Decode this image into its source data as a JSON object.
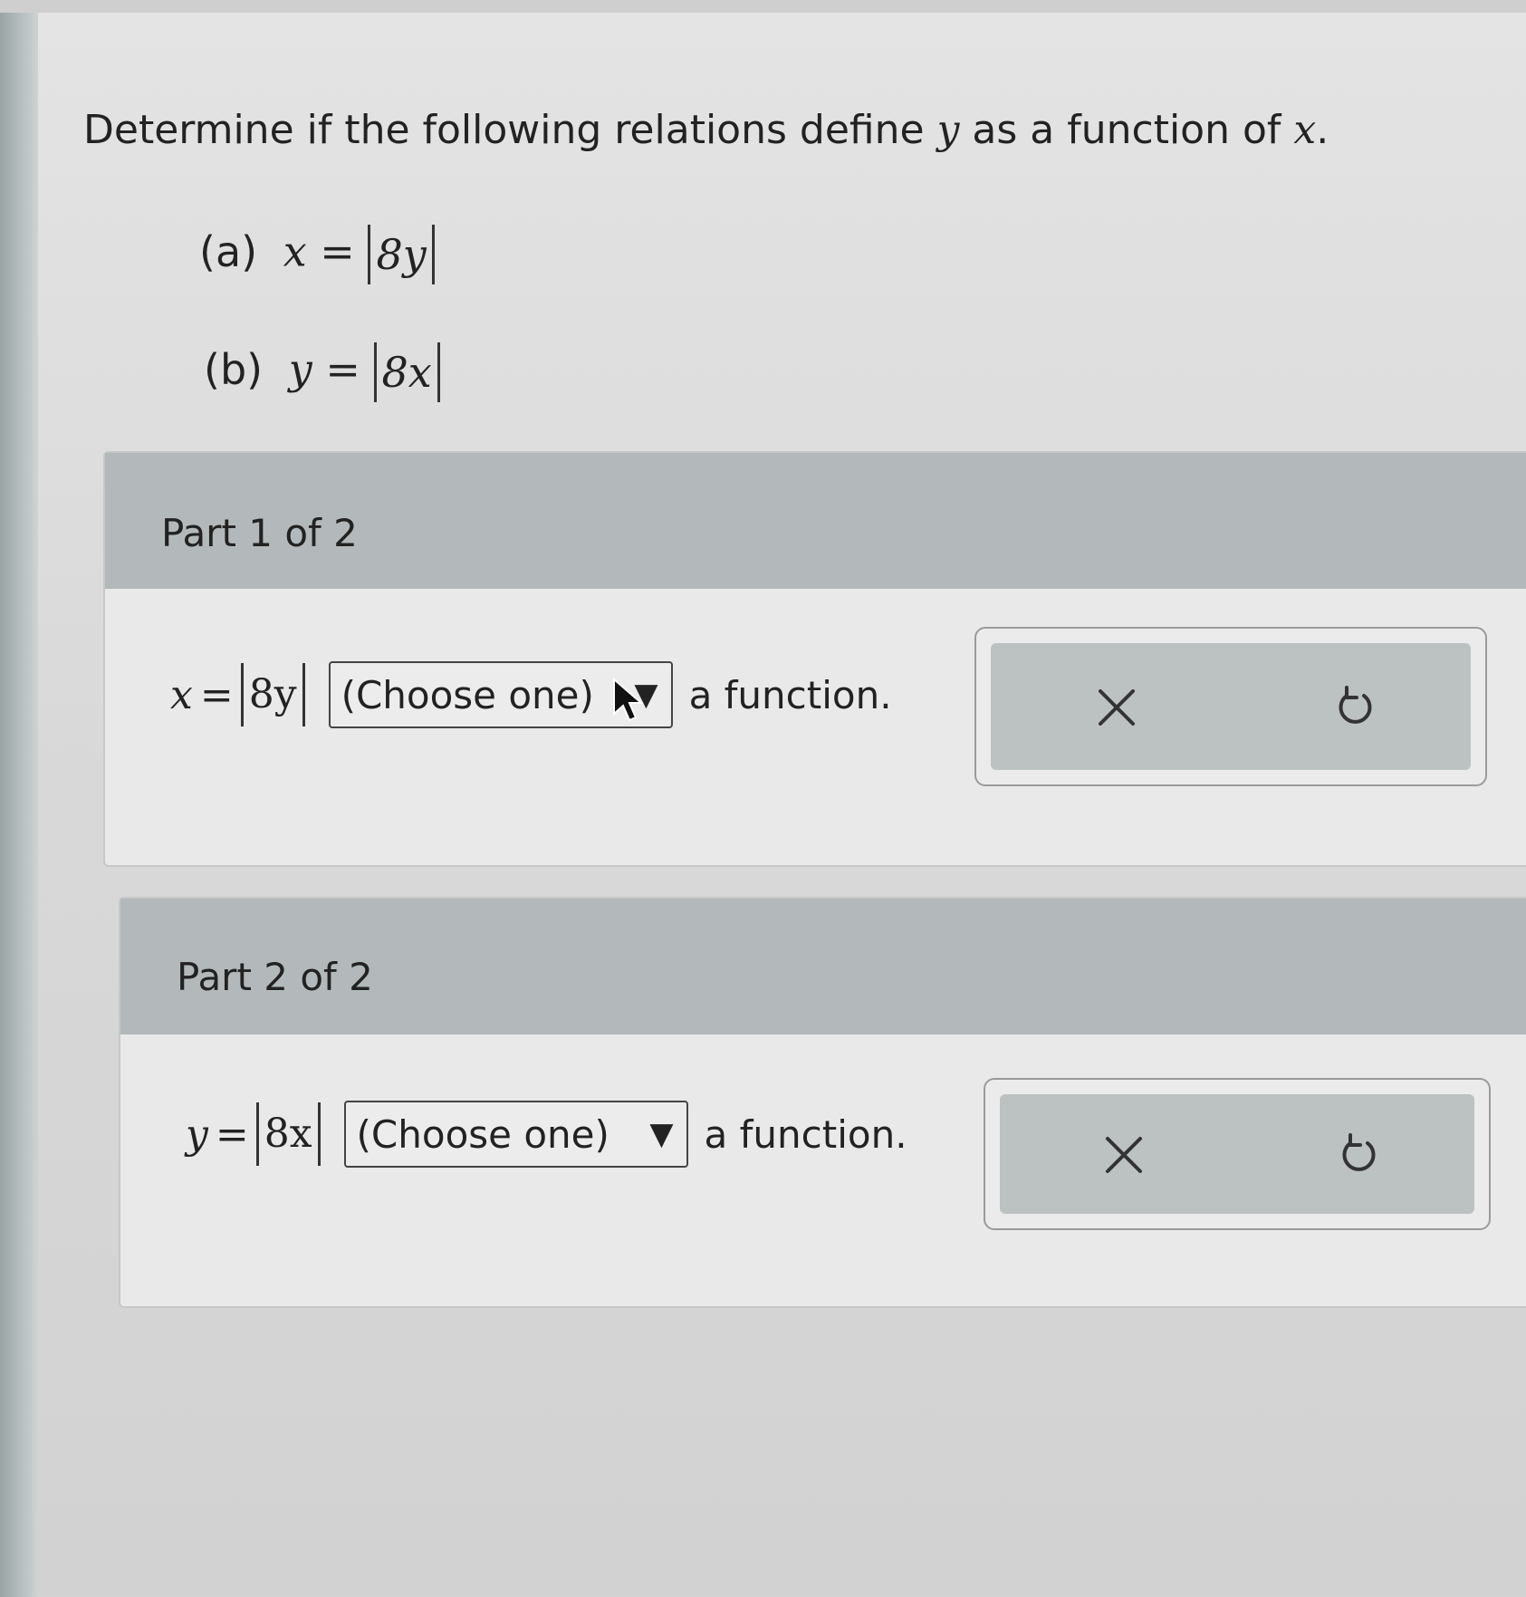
{
  "question": {
    "text_before": "Determine if the following relations define",
    "var_y": "y",
    "text_middle": "as a function of",
    "var_x": "x",
    "text_end": "."
  },
  "relations": [
    {
      "label": "(a)",
      "lhs": "x",
      "eq": "=",
      "abs": "8y"
    },
    {
      "label": "(b)",
      "lhs": "y",
      "eq": "=",
      "abs": "8x"
    }
  ],
  "parts": [
    {
      "title": "Part 1 of 2",
      "lhs": "x",
      "eq": "=",
      "abs": "8y",
      "select": "(Choose one)",
      "suffix": "a function."
    },
    {
      "title": "Part 2 of 2",
      "lhs": "y",
      "eq": "=",
      "abs": "8x",
      "select": "(Choose one)",
      "suffix": "a function."
    }
  ],
  "icons": {
    "dropdown": "triangle-down-icon",
    "clear": "close-icon",
    "reset": "undo-icon",
    "pointer": "mouse-pointer-icon"
  }
}
